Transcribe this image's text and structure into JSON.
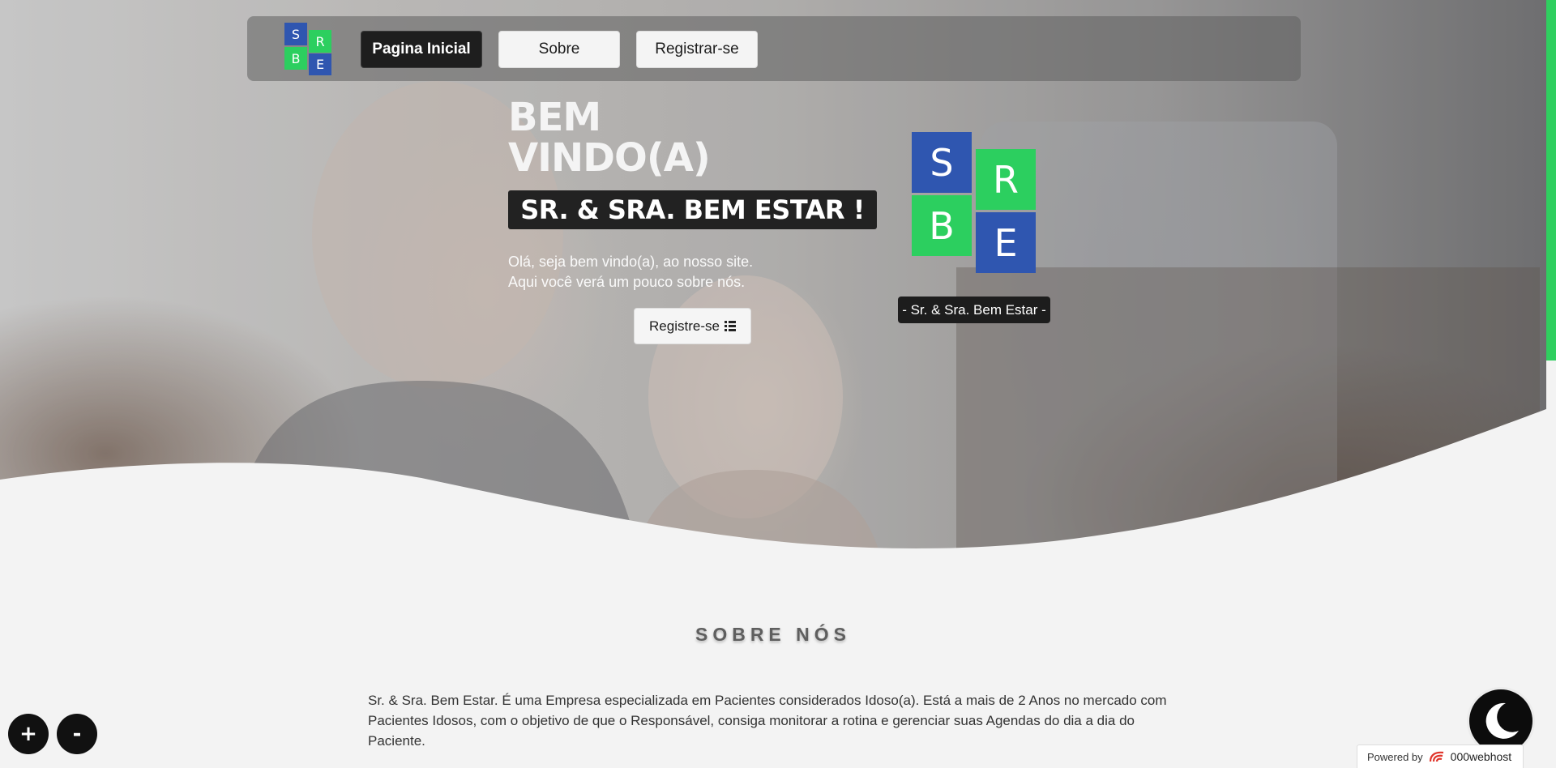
{
  "brand": {
    "logo_letters": [
      "S",
      "R",
      "B",
      "E"
    ]
  },
  "nav": {
    "items": [
      {
        "label": "Pagina Inicial",
        "active": true
      },
      {
        "label": "Sobre",
        "active": false
      },
      {
        "label": "Registrar-se",
        "active": false
      }
    ]
  },
  "hero": {
    "welcome_line1": "BEM",
    "welcome_line2": "VINDO(A)",
    "banner": "SR. & SRA. BEM ESTAR !",
    "intro_line1": "Olá, seja bem vindo(a), ao nosso site.",
    "intro_line2": "Aqui você verá um pouco sobre nós.",
    "cta_label": "Registre-se",
    "cta_icon": "list-icon",
    "logo_caption": "- Sr. & Sra. Bem Estar -"
  },
  "about": {
    "heading": "SOBRE NÓS",
    "paragraph": "Sr. & Sra. Bem Estar. É uma Empresa especializada em Pacientes considerados Idoso(a). Está a mais de 2 Anos no mercado com Pacientes Idosos, com o objetivo de que o Responsável, consiga monitorar a rotina e gerenciar suas Agendas do dia a dia do Paciente."
  },
  "controls": {
    "zoom_in": "+",
    "zoom_out": "-",
    "theme_icon": "moon-icon"
  },
  "footer_badge": {
    "prefix": "Powered by",
    "brand": "000webhost"
  },
  "colors": {
    "logo_blue": "#2f56b0",
    "logo_green": "#2ccf5f",
    "accent_strip": "#2fcf5f",
    "dark": "#1e1e1e"
  }
}
